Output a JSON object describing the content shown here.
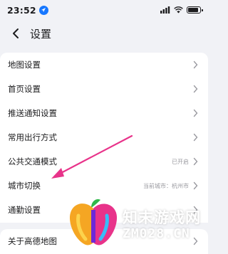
{
  "status_bar": {
    "time": "23:52",
    "icons": [
      "location-icon",
      "signal-icon",
      "wifi-icon",
      "battery-icon"
    ],
    "battery_level": 0.85
  },
  "header": {
    "title": "设置",
    "back_icon": "chevron-left-icon"
  },
  "settings": {
    "items": [
      {
        "label": "地图设置",
        "value": ""
      },
      {
        "label": "首页设置",
        "value": ""
      },
      {
        "label": "推送通知设置",
        "value": ""
      },
      {
        "label": "常用出行方式",
        "value": ""
      },
      {
        "label": "公共交通模式",
        "value": "已开启"
      },
      {
        "label": "城市切换",
        "value": "当前城市：杭州市"
      },
      {
        "label": "通勤设置",
        "value": ""
      }
    ],
    "about": {
      "label": "关于高德地图"
    }
  },
  "annotation": {
    "arrow_color": "#e8338a"
  },
  "watermark": {
    "text": "知末游戏网",
    "url": "ZM028.CN"
  },
  "colors": {
    "background": "#f1f2f6",
    "card": "#ffffff",
    "accent": "#1677ff",
    "secondary_text": "#9a9aa0"
  }
}
